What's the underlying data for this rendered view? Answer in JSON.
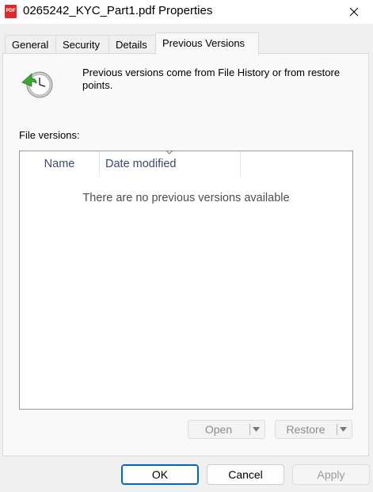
{
  "window": {
    "title": "0265242_KYC_Part1.pdf Properties",
    "file_icon_text": "PDF"
  },
  "tabs": [
    {
      "label": "General"
    },
    {
      "label": "Security"
    },
    {
      "label": "Details"
    },
    {
      "label": "Previous Versions",
      "active": true
    }
  ],
  "previous_versions": {
    "description": "Previous versions come from File History or from restore points.",
    "file_versions_label": "File versions:",
    "columns": {
      "name": "Name",
      "date_modified": "Date modified"
    },
    "empty_message": "There are no previous versions available",
    "open_label": "Open",
    "restore_label": "Restore"
  },
  "footer": {
    "ok_label": "OK",
    "cancel_label": "Cancel",
    "apply_label": "Apply"
  },
  "colors": {
    "accent": "#0067c0",
    "clock_arrow": "#3fa535",
    "pdf_icon": "#e0272a"
  }
}
